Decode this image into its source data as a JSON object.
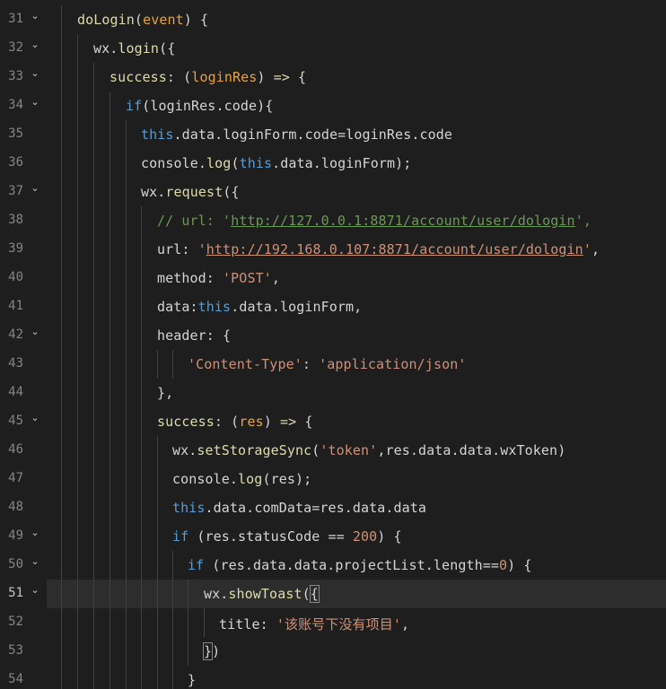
{
  "editor": {
    "current_line": 51,
    "lines": [
      {
        "num": "31",
        "code": "doLogin(event) {"
      },
      {
        "num": "32",
        "code": "wx.login({"
      },
      {
        "num": "33",
        "code": "success: (loginRes) => {"
      },
      {
        "num": "34",
        "code": "if(loginRes.code){"
      },
      {
        "num": "35",
        "code": "this.data.loginForm.code=loginRes.code"
      },
      {
        "num": "36",
        "code": "console.log(this.data.loginForm);"
      },
      {
        "num": "37",
        "code": "wx.request({"
      },
      {
        "num": "38",
        "code": "// url: 'http://127.0.0.1:8871/account/user/dologin',"
      },
      {
        "num": "39",
        "code": "url: 'http://192.168.0.107:8871/account/user/dologin',"
      },
      {
        "num": "40",
        "code": "method: 'POST',"
      },
      {
        "num": "41",
        "code": "data:this.data.loginForm,"
      },
      {
        "num": "42",
        "code": "header: {"
      },
      {
        "num": "43",
        "code": "'Content-Type': 'application/json'"
      },
      {
        "num": "44",
        "code": "},"
      },
      {
        "num": "45",
        "code": "success: (res) => {"
      },
      {
        "num": "46",
        "code": "wx.setStorageSync('token',res.data.data.wxToken)"
      },
      {
        "num": "47",
        "code": "console.log(res);"
      },
      {
        "num": "48",
        "code": "this.data.comData=res.data.data"
      },
      {
        "num": "49",
        "code": "if (res.statusCode == 200) {"
      },
      {
        "num": "50",
        "code": "if (res.data.data.projectList.length==0) {"
      },
      {
        "num": "51",
        "code": "wx.showToast({"
      },
      {
        "num": "52",
        "code": "title: '该账号下没有项目',"
      },
      {
        "num": "53",
        "code": "})"
      },
      {
        "num": "54",
        "code": "}"
      }
    ]
  },
  "colors": {
    "background": "#1e1e1e",
    "current_line": "#2d2d2d",
    "keyword_this": "#569cd6",
    "function": "#dcdcaa",
    "param": "#e8a33d",
    "string": "#ce9178",
    "number": "#b5cea8",
    "comment": "#6a9955"
  },
  "icons": {
    "fold": "chevron-down-icon"
  }
}
